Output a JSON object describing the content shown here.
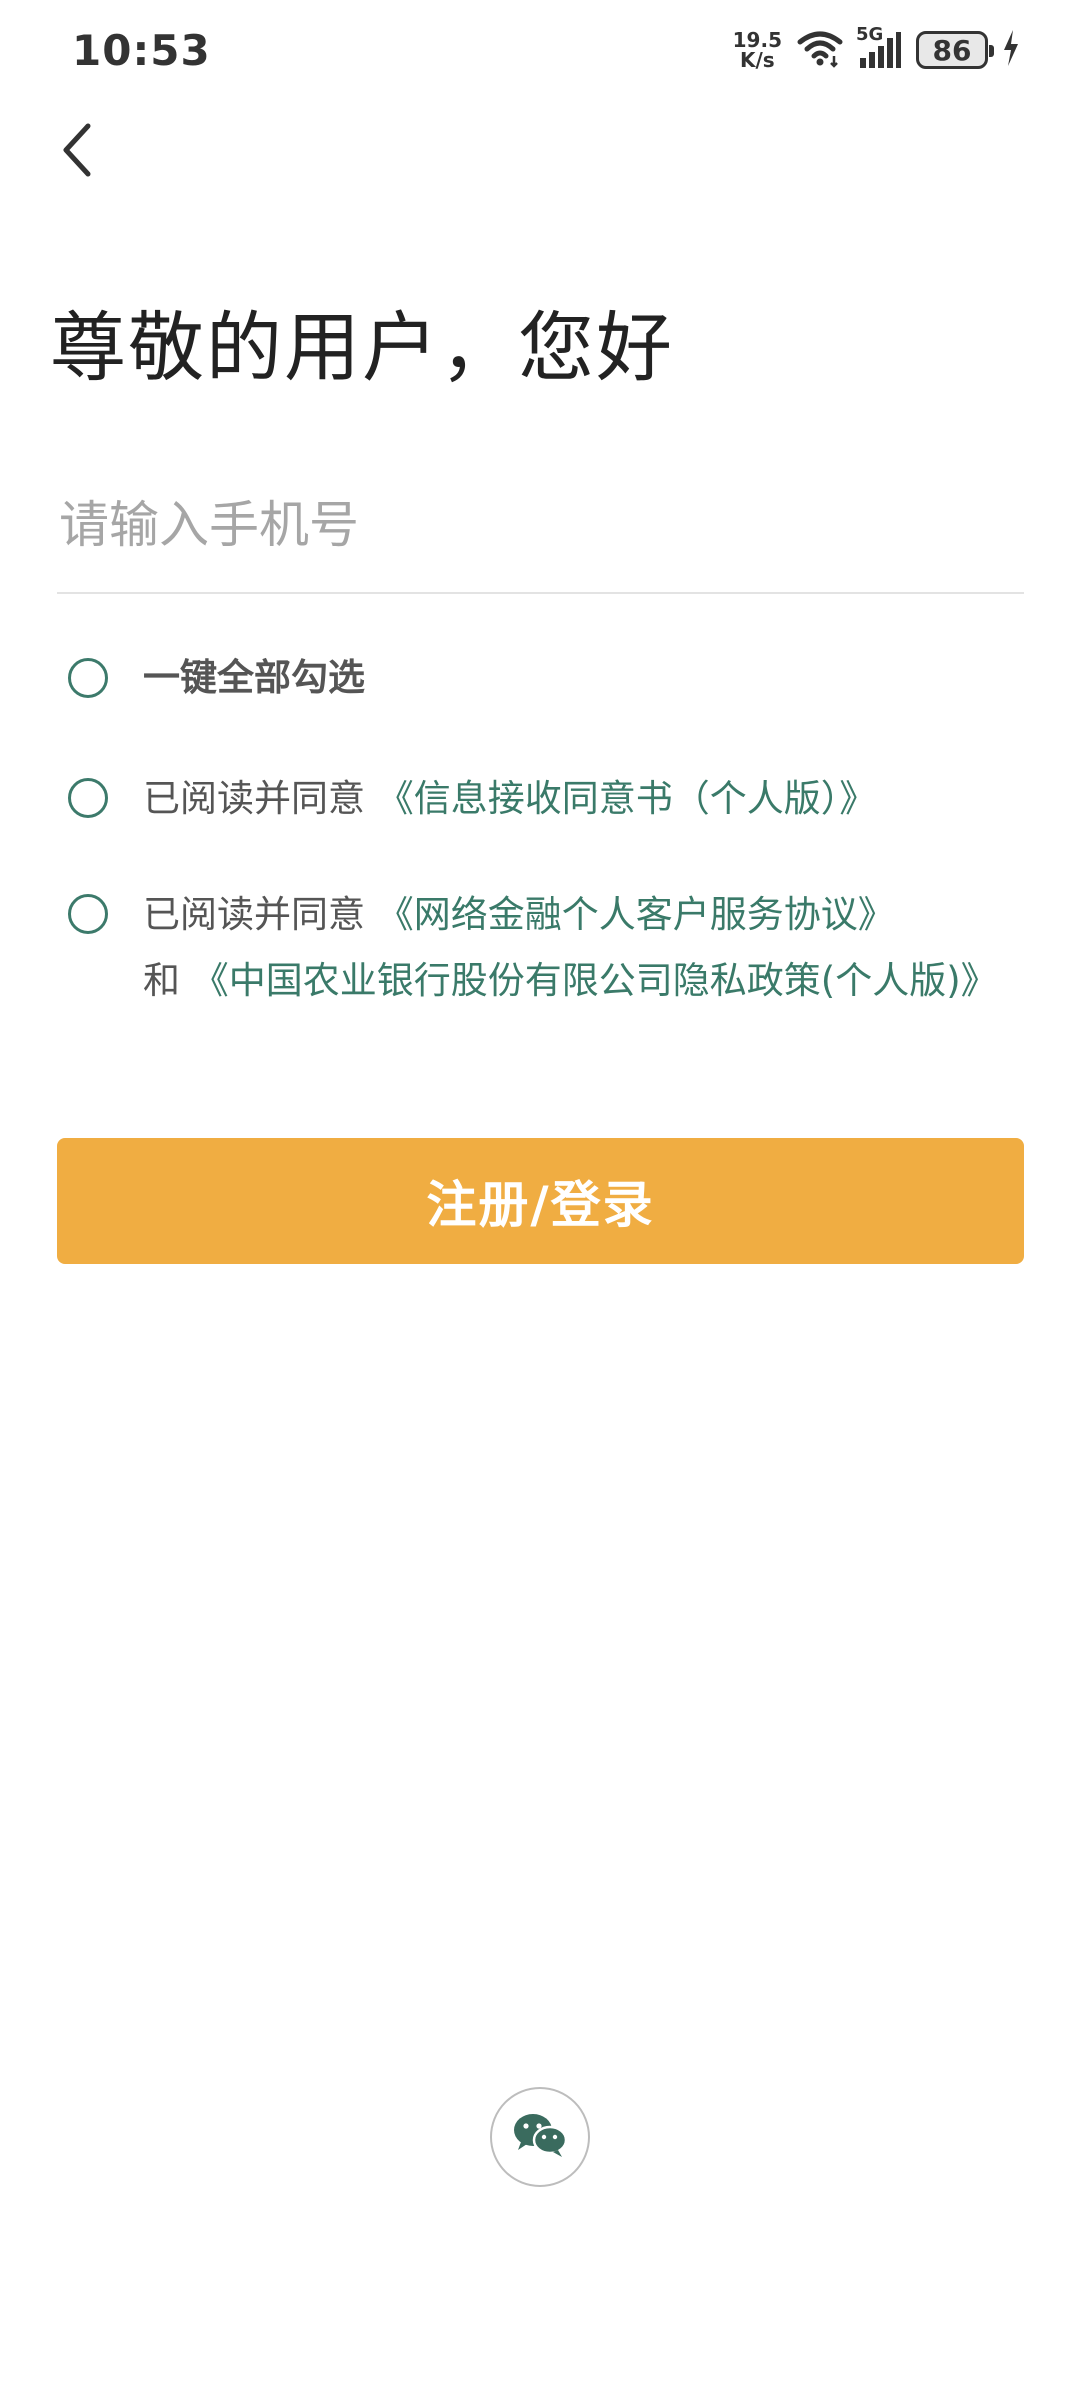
{
  "status_bar": {
    "time": "10:53",
    "net_speed_value": "19.5",
    "net_speed_unit": "K/s",
    "network_type": "5G",
    "battery_level": "86",
    "icons": [
      "wifi-icon",
      "cellular-signal-icon",
      "battery-icon",
      "charging-icon"
    ]
  },
  "header": {
    "back_icon": "chevron-left-icon"
  },
  "greeting": "尊敬的用户，您好",
  "phone_input": {
    "placeholder": "请输入手机号",
    "value": ""
  },
  "agreements": {
    "select_all_label": "一键全部勾选",
    "info_prefix": "已阅读并同意",
    "info_link": "《信息接收同意书（个人版）》",
    "terms_prefix": "已阅读并同意",
    "terms_link_1": "《网络金融个人客户服务协议》",
    "terms_and": "和",
    "terms_link_2": "《中国农业银行股份有限公司隐私政策(个人版)》"
  },
  "submit_button_label": "注册/登录",
  "social_login": {
    "icon": "wechat-icon"
  },
  "colors": {
    "accent_button": "#f0ad42",
    "link": "#3a7a69",
    "radio_border": "#3c7a6b",
    "placeholder": "#a6a6a6"
  }
}
